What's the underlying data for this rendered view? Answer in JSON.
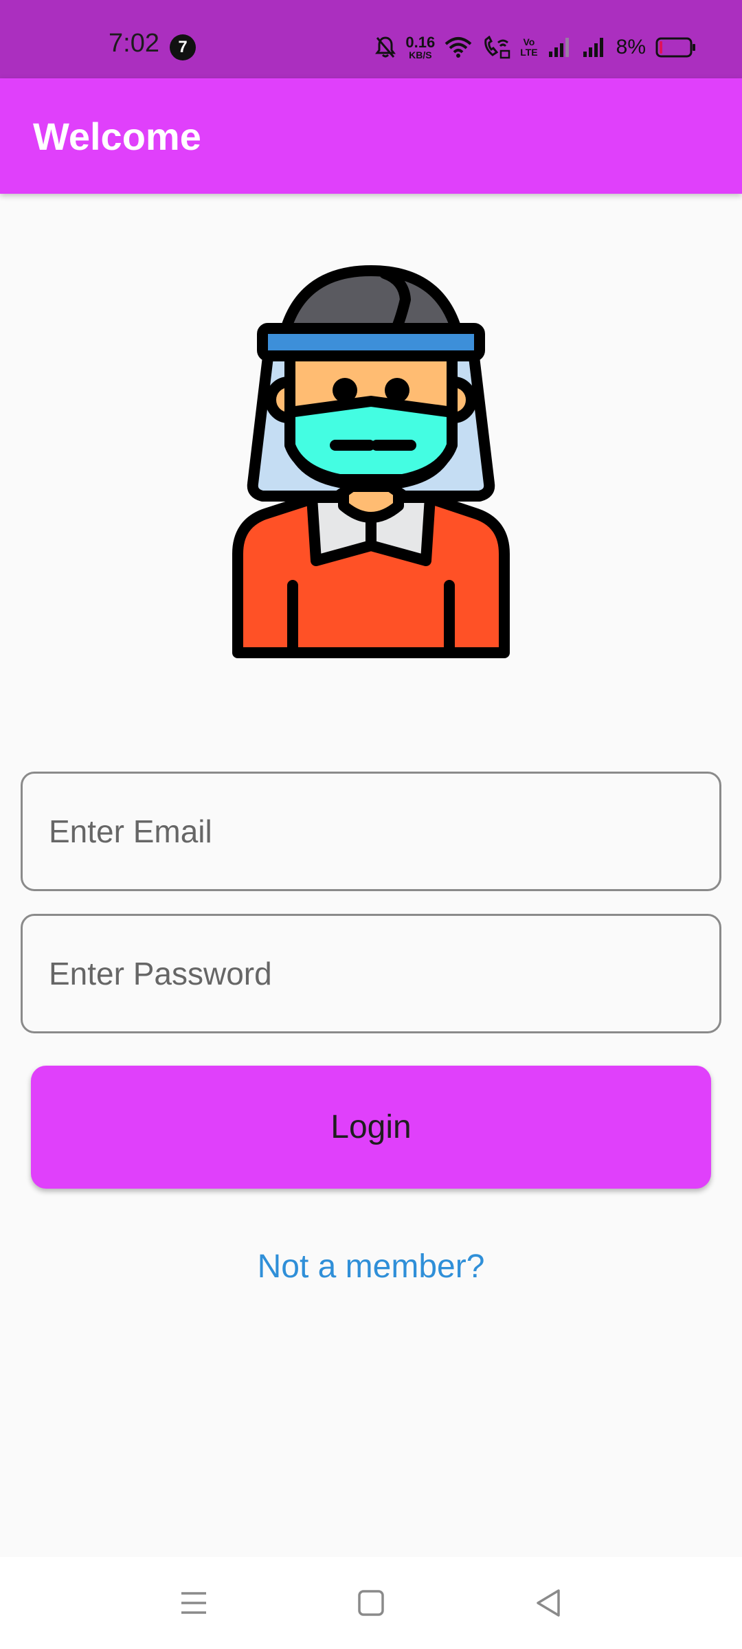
{
  "status_bar": {
    "time": "7:02",
    "notification_count": "7",
    "net_speed_value": "0.16",
    "net_speed_unit": "KB/S",
    "volte_top": "Vo",
    "volte_bottom": "LTE",
    "battery_percent": "8%"
  },
  "app_bar": {
    "title": "Welcome",
    "color": "#e040fb"
  },
  "avatar": {
    "icon": "masked-person-with-face-shield-icon"
  },
  "form": {
    "email_placeholder": "Enter Email",
    "email_value": "",
    "password_placeholder": "Enter Password",
    "password_value": "",
    "login_label": "Login",
    "signup_link": "Not a member?"
  },
  "nav_bar": {
    "buttons": [
      "recent-apps-icon",
      "home-icon",
      "back-icon"
    ]
  },
  "colors": {
    "status_bar": "#ab2fbf",
    "accent": "#e040fb",
    "link": "#2f8fd8",
    "background": "#fafafa"
  }
}
